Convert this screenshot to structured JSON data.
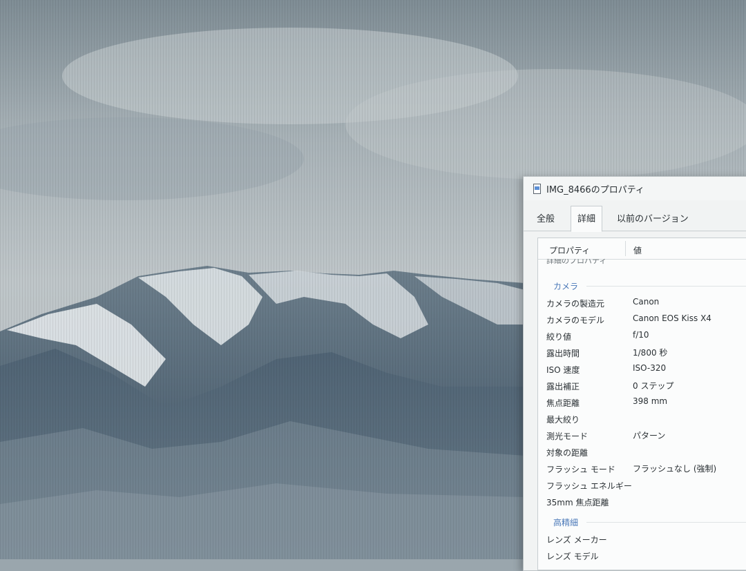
{
  "dialog": {
    "title": "IMG_8466のプロパティ",
    "tabs": [
      "全般",
      "詳細",
      "以前のバージョン"
    ],
    "selected_tab": "詳細",
    "columns": {
      "property": "プロパティ",
      "value": "値"
    },
    "cut_off_row": "詳細のプロパティ",
    "sections": {
      "camera": "カメラ",
      "advanced": "高精細"
    },
    "camera_rows": [
      {
        "key": "カメラの製造元",
        "value": "Canon"
      },
      {
        "key": "カメラのモデル",
        "value": "Canon EOS Kiss X4"
      },
      {
        "key": "絞り値",
        "value": "f/10"
      },
      {
        "key": "露出時間",
        "value": "1/800 秒"
      },
      {
        "key": "ISO 速度",
        "value": "ISO-320"
      },
      {
        "key": "露出補正",
        "value": "0 ステップ"
      },
      {
        "key": "焦点距離",
        "value": "398 mm"
      },
      {
        "key": "最大絞り",
        "value": ""
      },
      {
        "key": "測光モード",
        "value": "パターン"
      },
      {
        "key": "対象の距離",
        "value": ""
      },
      {
        "key": "フラッシュ モード",
        "value": "フラッシュなし (強制)"
      },
      {
        "key": "フラッシュ エネルギー",
        "value": ""
      },
      {
        "key": "35mm 焦点距離",
        "value": ""
      }
    ],
    "advanced_rows": [
      {
        "key": "レンズ メーカー",
        "value": ""
      },
      {
        "key": "レンズ モデル",
        "value": ""
      }
    ]
  },
  "colors": {
    "section_header": "#4a78b8",
    "dialog_bg": "#f1f3f3"
  }
}
